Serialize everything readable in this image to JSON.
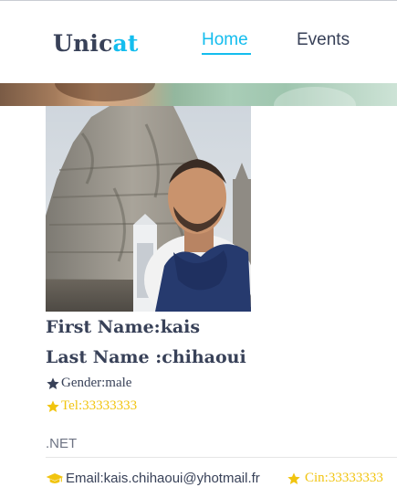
{
  "header": {
    "logo_main": "Unic",
    "logo_accent": "at",
    "nav": {
      "home": "Home",
      "events": "Events"
    }
  },
  "profile": {
    "first_name_label": "First Name:kais",
    "last_name_label": "Last Name :chihaoui",
    "gender": "Gender:male",
    "tel": "Tel:33333333",
    "skill": ".NET",
    "email": "Email:kais.chihaoui@yhotmail.fr",
    "cin": "Cin:33333333"
  },
  "icons": {
    "gender": "star-icon",
    "tel": "star-icon",
    "email": "graduation-cap-icon",
    "cin": "star-icon"
  },
  "colors": {
    "accent": "#14bdee",
    "text_dark": "#384158",
    "highlight_yellow": "#f1c40f",
    "text_muted": "#6d7383"
  }
}
